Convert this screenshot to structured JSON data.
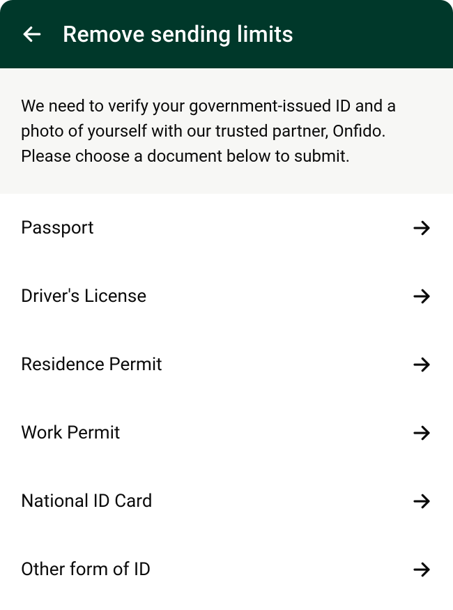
{
  "header": {
    "title": "Remove sending limits"
  },
  "description": "We need to verify your government-issued ID and a photo of yourself with our trusted partner, Onfido. Please choose a document below to submit.",
  "documents": [
    {
      "label": "Passport"
    },
    {
      "label": "Driver's License"
    },
    {
      "label": "Residence Permit"
    },
    {
      "label": "Work Permit"
    },
    {
      "label": "National ID Card"
    },
    {
      "label": "Other form of ID"
    }
  ]
}
